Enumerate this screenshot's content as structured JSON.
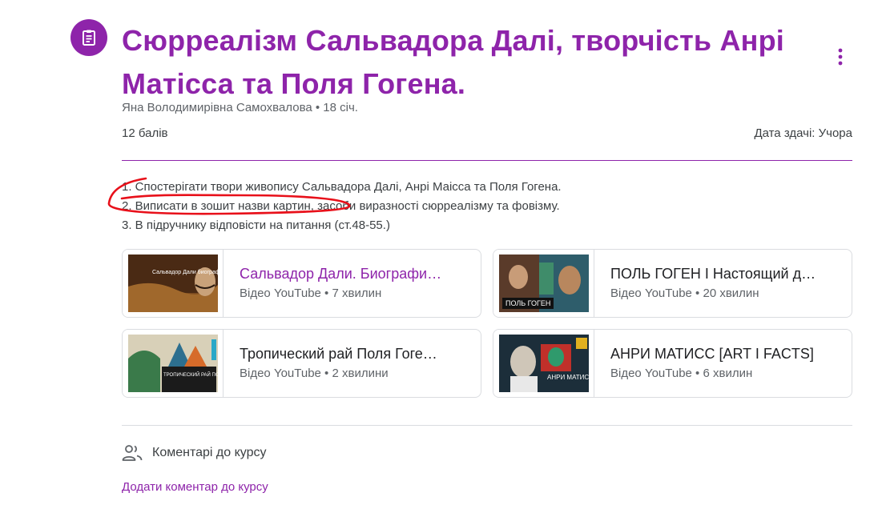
{
  "header": {
    "title": "Сюрреалізм Сальвадора Далі, творчість Анрі Матісса та Поля Гогена.",
    "meta": "Яна Володимирівна Самохвалова • 18 січ.",
    "points": "12 балів",
    "due": "Дата здачі: Учора",
    "accent_color": "#8e24aa"
  },
  "instructions": [
    "1. Спостерігати твори живопису Сальвадора Далі, Анрі Маісса та Поля Гогена.",
    "2. Виписати в зошит назви картин, засоби виразності сюрреалізму та фовізму.",
    "3. В підручнику відповісти на питання (ст.48-55.)"
  ],
  "attachments": [
    {
      "title": "Сальвадор Дали. Биографи…",
      "subtitle": "Відео YouTube • 7 хвилин",
      "thumb_label": "Сальвадор Дали биография и картины"
    },
    {
      "title": "ПОЛЬ ГОГЕН I Настоящий д…",
      "subtitle": "Відео YouTube • 20 хвилин",
      "thumb_label": "ПОЛЬ ГОГЕН"
    },
    {
      "title": "Тропический рай Поля Гоге…",
      "subtitle": "Відео YouTube • 2 хвилини",
      "thumb_label": "ТРОПИЧЕСКИЙ РАЙ ПОЛЯ ГОГЕНА. ПРАВДА И ВЫМЫСЕЛ"
    },
    {
      "title": "АНРИ МАТИСС [ART I FACTS]",
      "subtitle": "Відео YouTube • 6 хвилин",
      "thumb_label": "АНРИ МАТИСС"
    }
  ],
  "comments": {
    "label": "Коментарі до курсу",
    "add_label": "Додати коментар до курсу"
  },
  "icons": {
    "assignment": "assignment-icon",
    "more": "more-vert-icon",
    "people": "people-icon"
  }
}
